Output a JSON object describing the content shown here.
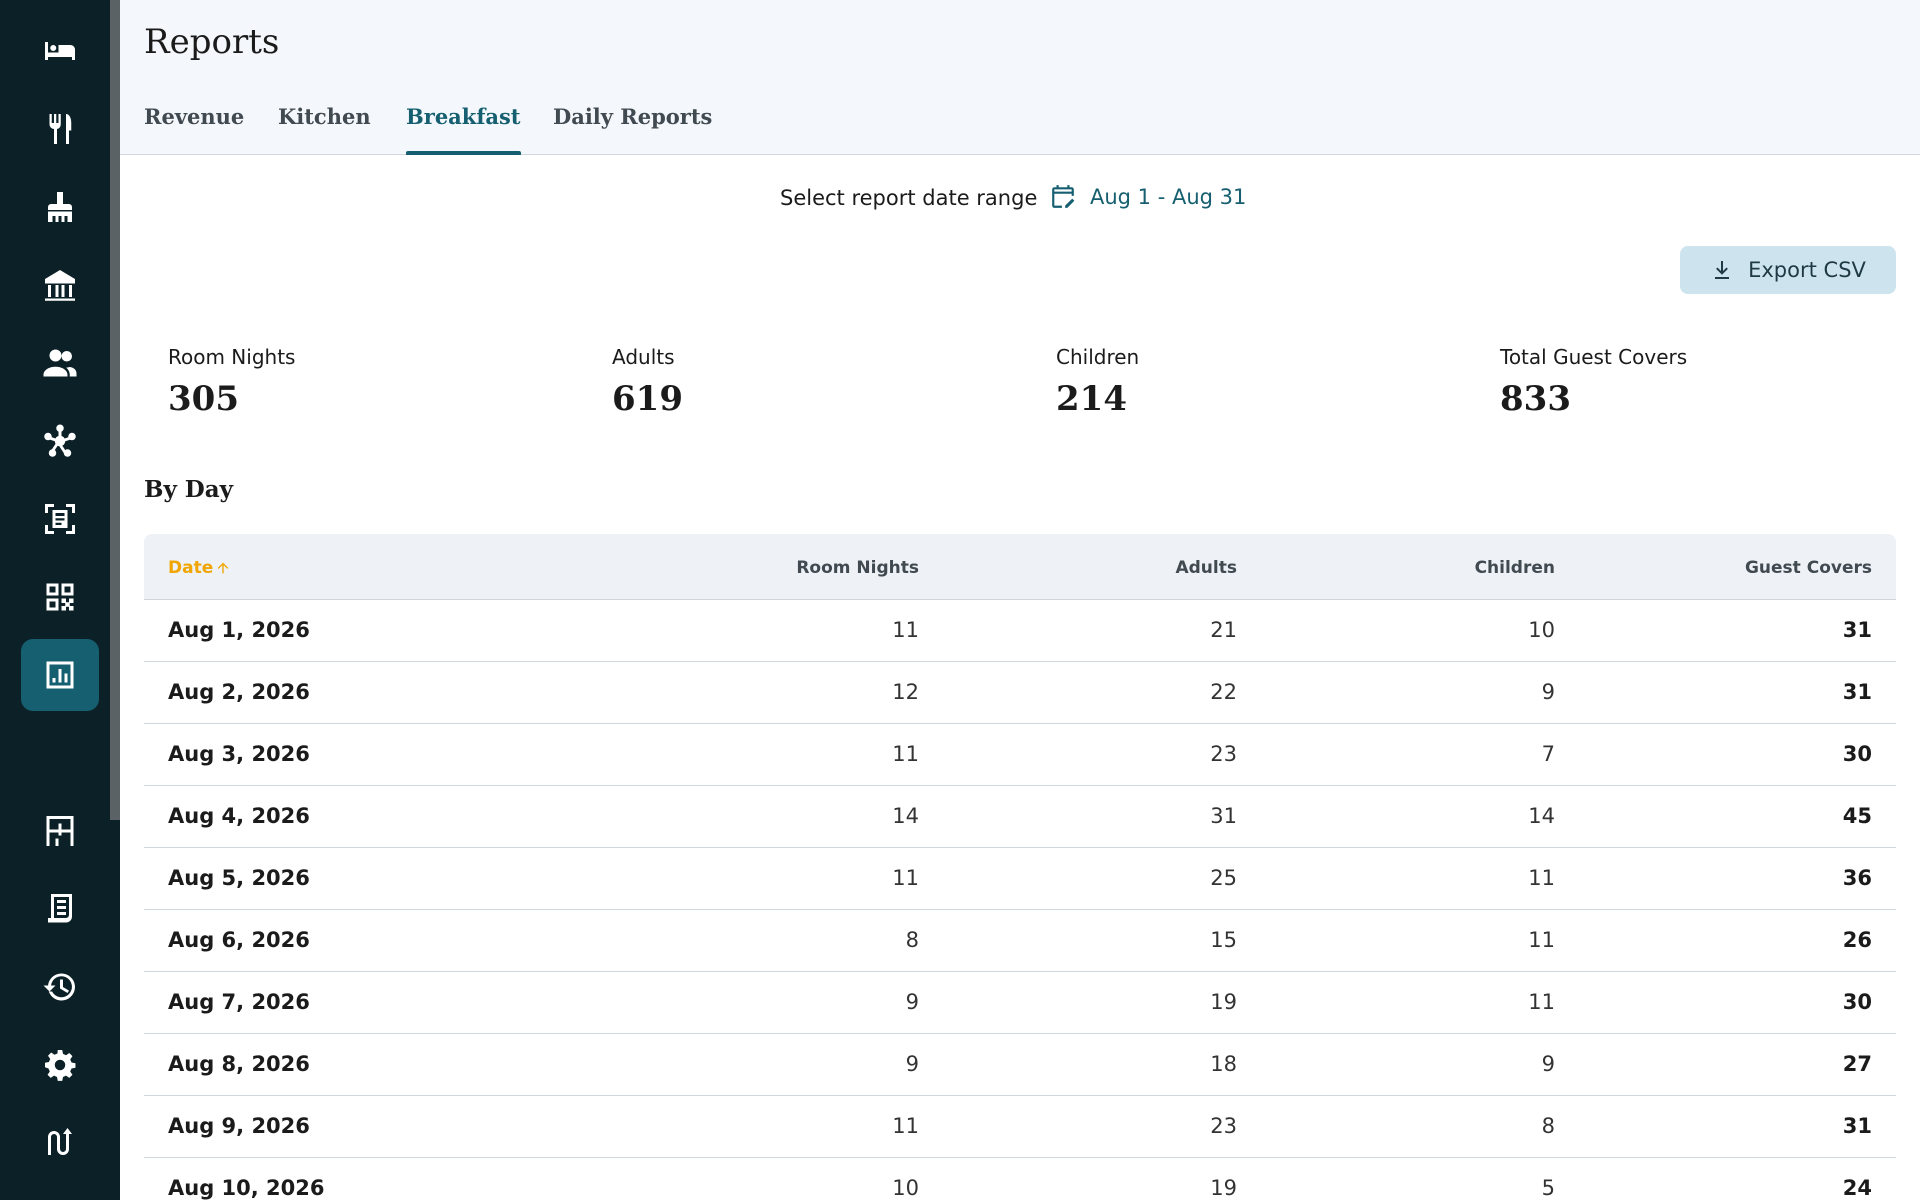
{
  "sidebar": {
    "items": [
      {
        "icon": "bed-icon",
        "name": "nav-rooms",
        "active": false
      },
      {
        "icon": "utensils-icon",
        "name": "nav-restaurant",
        "active": false
      },
      {
        "icon": "broom-icon",
        "name": "nav-housekeeping",
        "active": false
      },
      {
        "icon": "building-icon",
        "name": "nav-property",
        "active": false
      },
      {
        "icon": "people-icon",
        "name": "nav-guests",
        "active": false
      },
      {
        "icon": "network-icon",
        "name": "nav-integrations",
        "active": false
      },
      {
        "icon": "receipt-scan-icon",
        "name": "nav-invoices",
        "active": false
      },
      {
        "icon": "qr-code-icon",
        "name": "nav-qr-codes",
        "active": false
      },
      {
        "icon": "report-chart-icon",
        "name": "nav-reports",
        "active": true
      },
      {
        "icon": "moon-icon",
        "name": "nav-night-audit",
        "active": false
      },
      {
        "icon": "floorplan-icon",
        "name": "nav-floorplan",
        "active": false
      },
      {
        "icon": "document-icon",
        "name": "nav-documents",
        "active": false
      },
      {
        "icon": "history-icon",
        "name": "nav-history",
        "active": false
      },
      {
        "icon": "gear-icon",
        "name": "nav-settings",
        "active": false
      },
      {
        "icon": "logo-icon",
        "name": "nav-brand",
        "active": false
      }
    ]
  },
  "header": {
    "title": "Reports",
    "tabs": [
      {
        "label": "Revenue",
        "active": false
      },
      {
        "label": "Kitchen",
        "active": false
      },
      {
        "label": "Breakfast",
        "active": true
      },
      {
        "label": "Daily Reports",
        "active": false
      }
    ]
  },
  "date_range": {
    "label": "Select report date range",
    "value": "Aug 1 - Aug 31"
  },
  "export": {
    "label": "Export CSV"
  },
  "stats": [
    {
      "label": "Room Nights",
      "value": "305"
    },
    {
      "label": "Adults",
      "value": "619"
    },
    {
      "label": "Children",
      "value": "214"
    },
    {
      "label": "Total Guest Covers",
      "value": "833"
    }
  ],
  "section_title": "By Day",
  "table": {
    "columns": [
      "Date",
      "Room Nights",
      "Adults",
      "Children",
      "Guest Covers"
    ],
    "rows": [
      [
        "Aug 1, 2026",
        "11",
        "21",
        "10",
        "31"
      ],
      [
        "Aug 2, 2026",
        "12",
        "22",
        "9",
        "31"
      ],
      [
        "Aug 3, 2026",
        "11",
        "23",
        "7",
        "30"
      ],
      [
        "Aug 4, 2026",
        "14",
        "31",
        "14",
        "45"
      ],
      [
        "Aug 5, 2026",
        "11",
        "25",
        "11",
        "36"
      ],
      [
        "Aug 6, 2026",
        "8",
        "15",
        "11",
        "26"
      ],
      [
        "Aug 7, 2026",
        "9",
        "19",
        "11",
        "30"
      ],
      [
        "Aug 8, 2026",
        "9",
        "18",
        "9",
        "27"
      ],
      [
        "Aug 9, 2026",
        "11",
        "23",
        "8",
        "31"
      ],
      [
        "Aug 10, 2026",
        "10",
        "19",
        "5",
        "24"
      ]
    ]
  },
  "colors": {
    "sidebar_bg": "#0b2027",
    "accent": "#155f70",
    "sort_highlight": "#f0a500",
    "export_bg": "#cde3ee"
  }
}
